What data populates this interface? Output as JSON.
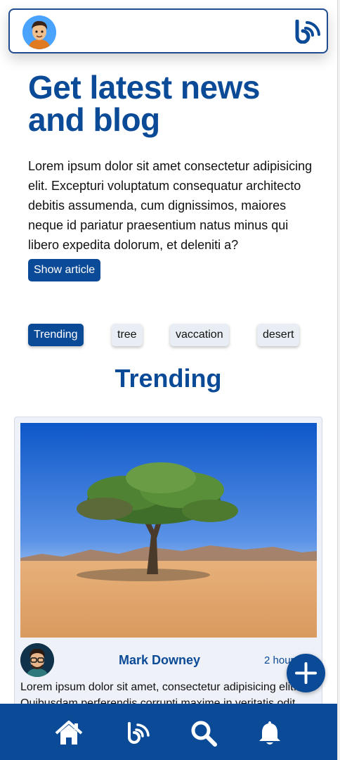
{
  "header": {
    "avatar_icon": "user-avatar-icon",
    "brand_icon": "rss-feed-icon"
  },
  "hero": {
    "title": "Get latest news and blog",
    "text": "Lorem ipsum dolor sit amet consectetur adipisicing elit. Excepturi voluptatum consequatur architecto debitis assumenda, cum dignissimos, maiores neque id pariatur praesentium natus minus qui libero expedita dolorum, et deleniti a?",
    "button_label": "Show article"
  },
  "tags": [
    {
      "label": "Trending",
      "active": true
    },
    {
      "label": "tree",
      "active": false
    },
    {
      "label": "vaccation",
      "active": false
    },
    {
      "label": "desert",
      "active": false
    }
  ],
  "section_title": "Trending",
  "card": {
    "image_alt": "tree-in-desert-photo",
    "author": "Mark Downey",
    "time": "2 hours",
    "excerpt_line1": "Lorem ipsum dolor sit amet, consectetur adipisicing elit.",
    "excerpt_line2": "Quibusdam perferendis corrupti maxime in veritatis odit"
  },
  "fab_icon": "plus-icon",
  "bottom_nav": [
    {
      "icon": "home-icon"
    },
    {
      "icon": "rss-feed-icon"
    },
    {
      "icon": "search-icon"
    },
    {
      "icon": "bell-icon"
    }
  ],
  "colors": {
    "brand": "#0b4a96",
    "card_bg": "#eef2f8",
    "tag_bg": "#e9eef5"
  }
}
